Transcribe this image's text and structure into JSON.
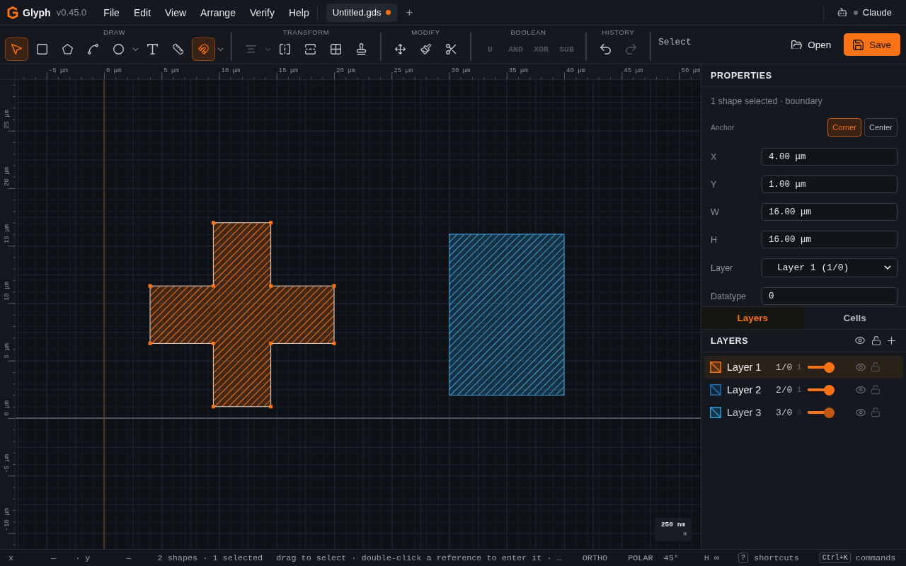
{
  "app": {
    "name": "Glyph",
    "version": "v0.45.0"
  },
  "menu": [
    {
      "label": "File"
    },
    {
      "label": "Edit"
    },
    {
      "label": "View"
    },
    {
      "label": "Arrange"
    },
    {
      "label": "Verify"
    },
    {
      "label": "Help"
    }
  ],
  "document_tabs": [
    {
      "label": "Untitled.gds",
      "modified": true,
      "selected": true
    }
  ],
  "new_tab": "+",
  "user": {
    "name": "Claude",
    "connected": false
  },
  "toolbar": {
    "groups": [
      {
        "label": "DRAW",
        "tools": [
          {
            "kind": "icon",
            "selected": true,
            "disabled": false,
            "dropdown": false
          },
          {
            "kind": "icon",
            "selected": false,
            "disabled": false,
            "dropdown": false
          },
          {
            "kind": "icon",
            "selected": false,
            "disabled": false,
            "dropdown": false
          },
          {
            "kind": "icon",
            "selected": false,
            "disabled": false,
            "dropdown": false
          },
          {
            "kind": "icon",
            "selected": false,
            "disabled": false,
            "dropdown": true
          },
          {
            "kind": "icon",
            "selected": false,
            "disabled": false,
            "dropdown": false
          },
          {
            "kind": "icon",
            "selected": false,
            "disabled": false,
            "dropdown": false
          },
          {
            "kind": "icon",
            "selected": true,
            "disabled": false,
            "dropdown": true
          }
        ]
      },
      {
        "label": "TRANSFORM",
        "tools": [
          {
            "kind": "icon",
            "selected": false,
            "disabled": true,
            "dropdown": true
          },
          {
            "kind": "icon",
            "selected": false,
            "disabled": false,
            "dropdown": false
          },
          {
            "kind": "icon",
            "selected": false,
            "disabled": false,
            "dropdown": false
          },
          {
            "kind": "icon",
            "selected": false,
            "disabled": false,
            "dropdown": false
          },
          {
            "kind": "icon",
            "selected": false,
            "disabled": false,
            "dropdown": false
          }
        ]
      },
      {
        "label": "MODIFY",
        "tools": [
          {
            "kind": "icon",
            "selected": false,
            "disabled": false,
            "dropdown": false
          },
          {
            "kind": "icon",
            "selected": false,
            "disabled": false,
            "dropdown": false
          },
          {
            "kind": "icon",
            "selected": false,
            "disabled": false,
            "dropdown": false
          }
        ]
      },
      {
        "label": "BOOLEAN",
        "tools": [
          {
            "kind": "text",
            "label": "U",
            "disabled": true
          },
          {
            "kind": "text",
            "label": "AND",
            "disabled": true
          },
          {
            "kind": "text",
            "label": "XOR",
            "disabled": true
          },
          {
            "kind": "text",
            "label": "SUB",
            "disabled": true
          }
        ]
      },
      {
        "label": "HISTORY",
        "tools": [
          {
            "kind": "icon",
            "selected": false,
            "disabled": false,
            "dropdown": false
          },
          {
            "kind": "icon",
            "selected": false,
            "disabled": true,
            "dropdown": false
          }
        ]
      }
    ],
    "mode": "Select"
  },
  "file_actions": [
    {
      "label": "Open",
      "kind": "secondary"
    },
    {
      "label": "Save",
      "kind": "primary"
    }
  ],
  "canvas": {
    "ruler_x": [
      "-5 μm",
      "0 μm",
      "5 μm",
      "10 μm",
      "15 μm",
      "20 μm",
      "25 μm",
      "30 μm",
      "35 μm",
      "40 μm",
      "45 μm",
      "50 μm"
    ],
    "ruler_y": [
      "25 μm",
      "20 μm",
      "15 μm",
      "10 μm",
      "5 μm",
      "0 μm",
      "-5 μm",
      "-10 μm"
    ],
    "shapes": [
      {
        "kind": "cross",
        "color": "#f97316",
        "selected": true
      },
      {
        "kind": "rectangle",
        "color": "#3a9fdc",
        "selected": false
      }
    ],
    "scale": {
      "label": "250 nm",
      "hint": "H"
    }
  },
  "properties": {
    "title": "PROPERTIES",
    "summary": "1 shape selected · boundary",
    "anchor": {
      "label": "Anchor",
      "options": [
        {
          "label": "Corner",
          "selected": true
        },
        {
          "label": "Center",
          "selected": false
        }
      ]
    },
    "fields": [
      {
        "label": "X",
        "value": "4.00 μm",
        "kind": "input"
      },
      {
        "label": "Y",
        "value": "1.00 μm",
        "kind": "input"
      },
      {
        "label": "W",
        "value": "16.00 μm",
        "kind": "input"
      },
      {
        "label": "H",
        "value": "16.00 μm",
        "kind": "input"
      },
      {
        "label": "Layer",
        "value": "Layer 1 (1/0)",
        "kind": "select"
      },
      {
        "label": "Datatype",
        "value": "0",
        "kind": "input"
      }
    ]
  },
  "panel_tabs": [
    {
      "label": "Layers",
      "selected": true
    },
    {
      "label": "Cells",
      "selected": false
    }
  ],
  "layers": {
    "title": "LAYERS",
    "items": [
      {
        "name": "Layer 1",
        "number": "1/0",
        "count": "1",
        "level": 1,
        "color": "#f97316",
        "selected": true,
        "visible": true,
        "locked": false,
        "empty": false
      },
      {
        "name": "Layer 2",
        "number": "2/0",
        "count": "1",
        "level": 1,
        "color": "#1f6fb2",
        "selected": false,
        "visible": true,
        "locked": false,
        "empty": false
      },
      {
        "name": "Layer 3",
        "number": "3/0",
        "count": "0",
        "level": 1,
        "color": "#2e9ad4",
        "selected": false,
        "visible": true,
        "locked": false,
        "empty": true
      }
    ]
  },
  "status_bar": {
    "x_label": "x",
    "x_value": "—",
    "y_label": "· y",
    "y_value": "—",
    "selection": "2 shapes · 1 selected",
    "hint": "drag to select · double-click a reference to enter it · …",
    "toggles": [
      {
        "label": "ORTHO"
      },
      {
        "label": "POLAR"
      }
    ],
    "angle": "45°",
    "grid": "H ∞",
    "shortcuts": [
      {
        "key": "?",
        "label": "shortcuts"
      },
      {
        "key": "Ctrl+K",
        "label": "commands"
      }
    ]
  }
}
